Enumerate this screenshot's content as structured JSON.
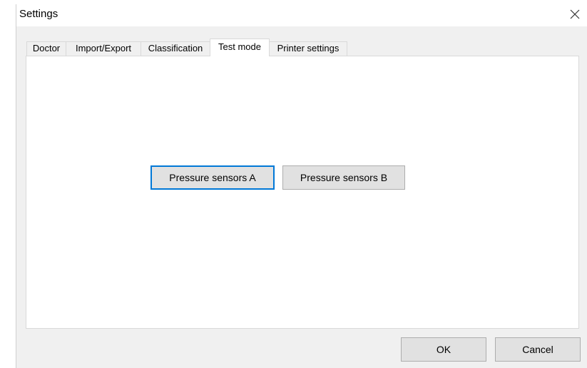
{
  "window": {
    "title": "Settings"
  },
  "tabs": [
    {
      "label": "Doctor",
      "active": false
    },
    {
      "label": "Import/Export",
      "active": false
    },
    {
      "label": "Classification",
      "active": false
    },
    {
      "label": "Test mode",
      "active": true
    },
    {
      "label": "Printer settings",
      "active": false
    }
  ],
  "test_mode": {
    "pressure_a_label": "Pressure sensors A",
    "pressure_b_label": "Pressure sensors B"
  },
  "footer": {
    "ok_label": "OK",
    "cancel_label": "Cancel"
  },
  "icons": {
    "close": "close-icon"
  },
  "colors": {
    "focus_border": "#0078d7",
    "button_face": "#e1e1e1",
    "dialog_background": "#f0f0f0"
  }
}
